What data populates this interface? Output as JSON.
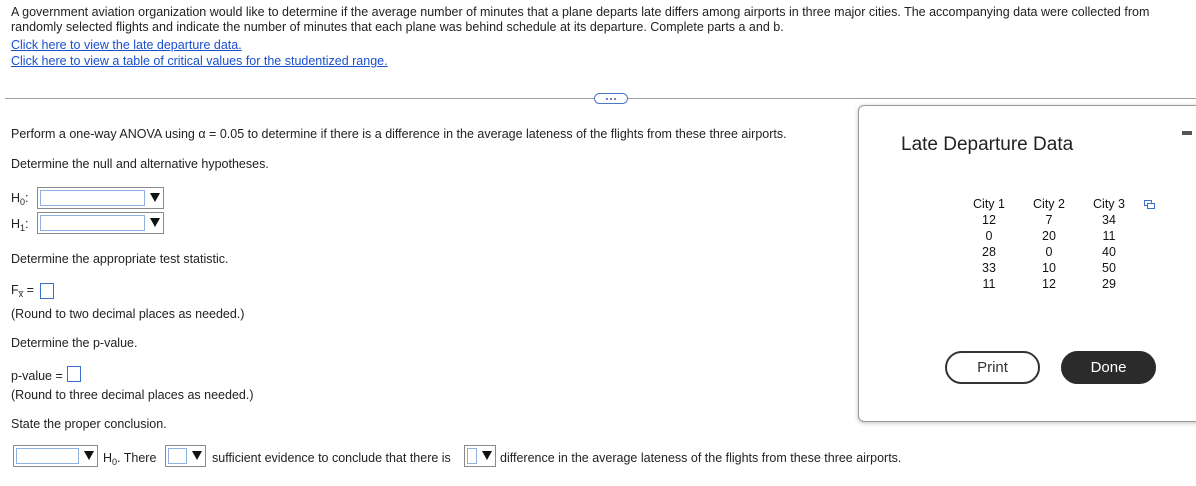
{
  "intro": {
    "line1": "A government aviation organization would like to determine if the average number of minutes that a plane departs late differs among airports in three major cities. The accompanying data were collected from",
    "line2": "randomly selected flights and indicate the number of minutes that each plane was behind schedule at its departure. Complete parts a and b.",
    "link_data": "Click here to view the late departure data.",
    "link_table": "Click here to view a table of critical values for the studentized range."
  },
  "question": {
    "prompt": "Perform a one-way ANOVA using α = 0.05 to determine if there is a difference in the average lateness of the flights from these three airports.",
    "hypotheses_prompt": "Determine the null and alternative hypotheses.",
    "h0_label": "H",
    "h0_sub": "0",
    "h1_label": "H",
    "h1_sub": "1",
    "stat_prompt": "Determine the appropriate test statistic.",
    "f_label": "F",
    "f_sub": "x̅",
    "f_eq": " =",
    "round2": "(Round to two decimal places as needed.)",
    "pvalue_prompt": "Determine the p-value.",
    "pvalue_label": "p-value =",
    "round3": "(Round to three decimal places as needed.)",
    "conclusion_prompt": "State the proper conclusion.",
    "c_h": "H",
    "c_sub": "0",
    "c_there": ". There",
    "c_mid": "sufficient evidence to conclude that there is",
    "c_end": "difference in the average lateness of the flights from these three airports."
  },
  "panel": {
    "title": "Late Departure Data",
    "columns": [
      "City 1",
      "City 2",
      "City 3"
    ],
    "rows": [
      [
        "12",
        "7",
        "34"
      ],
      [
        "0",
        "20",
        "11"
      ],
      [
        "28",
        "0",
        "40"
      ],
      [
        "33",
        "10",
        "50"
      ],
      [
        "11",
        "12",
        "29"
      ]
    ],
    "print_label": "Print",
    "done_label": "Done"
  }
}
